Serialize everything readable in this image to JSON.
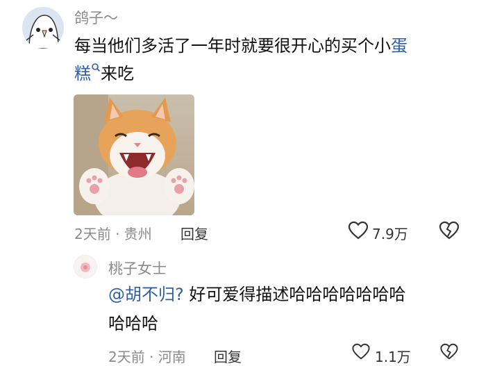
{
  "comment": {
    "username": "鸽子～",
    "text_main": "每当他们多活了一年时就要很开心的买个小",
    "link_part1": "蛋",
    "link_part2": "糕",
    "text_tail": "来吃",
    "time_location": "2天前 · 贵州",
    "reply_label": "回复",
    "likes": "7.9万"
  },
  "reply": {
    "username": "桃子女士",
    "mention": "@胡不归?",
    "text_line1": " 好可爱得描述哈哈哈哈哈哈哈",
    "text_line2": "哈哈哈",
    "time_location": "2天前 · 河南",
    "reply_label": "回复",
    "likes": "1.1万"
  },
  "icons": {
    "like": "heart-outline-icon",
    "dislike": "broken-heart-icon",
    "search": "search-icon"
  },
  "colors": {
    "link": "#2f5fa6",
    "meta": "#8a8a8a"
  }
}
